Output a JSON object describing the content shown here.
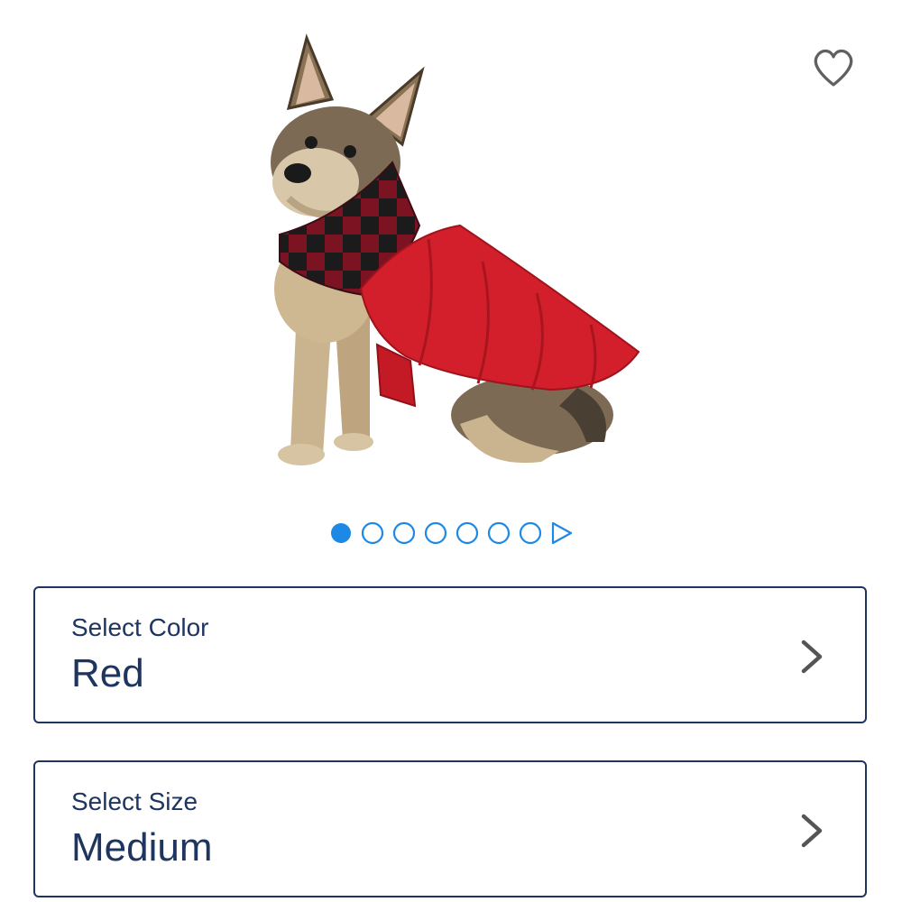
{
  "product": {
    "image_alt": "Dog wearing red puffer coat with buffalo plaid collar",
    "favorite_icon": "heart-outline-icon"
  },
  "carousel": {
    "total_dots": 7,
    "active_index": 0,
    "active_color": "#1e88e5",
    "dot_color": "#1e88e5",
    "next_icon": "play-triangle-icon"
  },
  "color_selector": {
    "label": "Select Color",
    "value": "Red",
    "icon": "chevron-right-icon"
  },
  "size_selector": {
    "label": "Select Size",
    "value": "Medium",
    "icon": "chevron-right-icon"
  },
  "theme": {
    "text_color": "#1e3560",
    "border_color": "#1e3560"
  }
}
